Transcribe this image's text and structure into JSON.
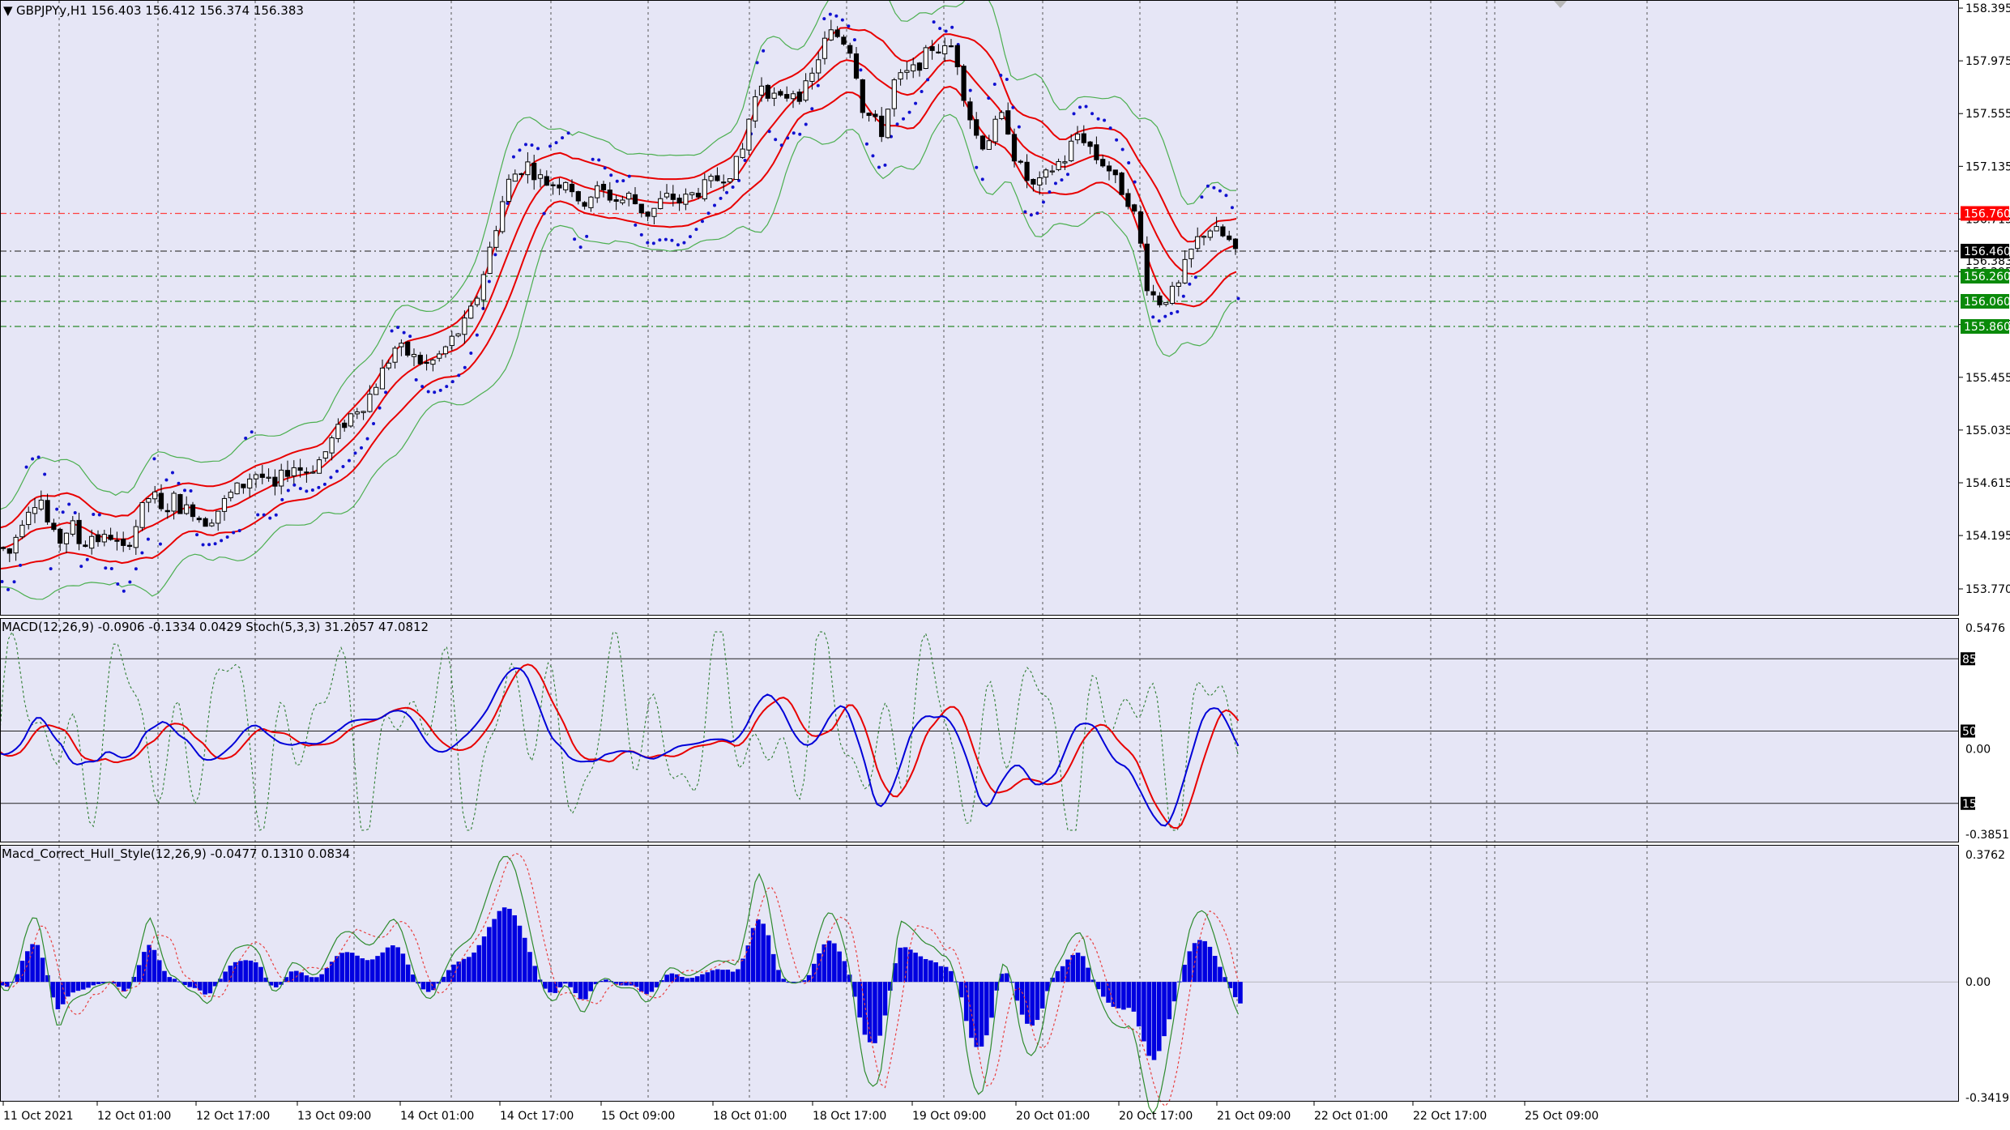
{
  "colors": {
    "background": "#e6e6f6",
    "candle_up": "#ffffff",
    "candle_down": "#000000",
    "envelope": "#e80000",
    "bollinger": "#4caf50",
    "psar": "#1010d0",
    "macd_main": "#0000d8",
    "macd_signal": "#e80000",
    "stoch": "#2e7d32",
    "hist": "#0000e0",
    "hull_main": "#2e8b2e",
    "hull_signal": "#e84040",
    "tag_red": "#ff0000",
    "tag_black": "#000000",
    "tag_green": "#0a8a0a",
    "hline_red": "#ff4040",
    "hline_black": "#444444",
    "hline_green": "#2a8a2a"
  },
  "panel1": {
    "header": "GBPJPYy,H1  156.403 156.412 156.374 156.383",
    "price_ticks": [
      "158.395",
      "157.975",
      "157.555",
      "157.135",
      "156.715",
      "156.295",
      "155.875",
      "155.455",
      "155.035",
      "154.615",
      "154.195",
      "153.770"
    ],
    "hidden_tick_fragment": "156.383",
    "price_tags": [
      {
        "text": "156.760",
        "color": "red",
        "level": 156.76
      },
      {
        "text": "156.460",
        "color": "black",
        "level": 156.46
      },
      {
        "text": "156.260",
        "color": "green",
        "level": 156.26
      },
      {
        "text": "156.060",
        "color": "green",
        "level": 156.06
      },
      {
        "text": "155.860",
        "color": "green",
        "level": 155.86
      }
    ]
  },
  "panel2": {
    "header": "MACD(12,26,9) -0.0906 -0.1334 0.0429  Stoch(5,3,3) 31.2057 47.0812",
    "ticks": [
      "0.5476",
      "0.00",
      "-0.3851"
    ],
    "level_tags": [
      "85",
      "50",
      "15"
    ]
  },
  "panel3": {
    "header": "Macd_Correct_Hull_Style(12,26,9) -0.0477 0.1310 0.0834",
    "ticks": [
      "0.3762",
      "0.00",
      "-0.3419"
    ]
  },
  "time_labels": [
    "11 Oct 2021",
    "12 Oct 01:00",
    "12 Oct 17:00",
    "13 Oct 09:00",
    "14 Oct 01:00",
    "14 Oct 17:00",
    "15 Oct 09:00",
    "18 Oct 01:00",
    "18 Oct 17:00",
    "19 Oct 09:00",
    "20 Oct 01:00",
    "20 Oct 17:00",
    "21 Oct 09:00",
    "22 Oct 01:00",
    "22 Oct 17:00",
    "25 Oct 09:00"
  ],
  "chart_data": {
    "type": "candlestick",
    "symbol": "GBPJPYy",
    "timeframe": "H1",
    "ylim": [
      153.77,
      158.395
    ],
    "close_path": [
      [
        0,
        154.1
      ],
      [
        10,
        154.05
      ],
      [
        20,
        154.3
      ],
      [
        30,
        154.45
      ],
      [
        40,
        154.5
      ],
      [
        50,
        154.2
      ],
      [
        60,
        154.15
      ],
      [
        70,
        154.3
      ],
      [
        80,
        154.1
      ],
      [
        90,
        154.2
      ],
      [
        100,
        154.15
      ],
      [
        110,
        154.2
      ],
      [
        120,
        154.05
      ],
      [
        130,
        154.2
      ],
      [
        140,
        154.4
      ],
      [
        150,
        154.55
      ],
      [
        160,
        154.35
      ],
      [
        170,
        154.5
      ],
      [
        180,
        154.4
      ],
      [
        190,
        154.4
      ],
      [
        200,
        154.3
      ],
      [
        210,
        154.35
      ],
      [
        220,
        154.45
      ],
      [
        230,
        154.55
      ],
      [
        240,
        154.6
      ],
      [
        250,
        154.7
      ],
      [
        260,
        154.65
      ],
      [
        270,
        154.55
      ],
      [
        280,
        154.7
      ],
      [
        290,
        154.75
      ],
      [
        300,
        154.7
      ],
      [
        310,
        154.75
      ],
      [
        320,
        154.85
      ],
      [
        330,
        155.0
      ],
      [
        340,
        155.1
      ],
      [
        350,
        155.2
      ],
      [
        360,
        155.25
      ],
      [
        370,
        155.4
      ],
      [
        380,
        155.55
      ],
      [
        390,
        155.7
      ],
      [
        400,
        155.65
      ],
      [
        410,
        155.6
      ],
      [
        420,
        155.55
      ],
      [
        430,
        155.6
      ],
      [
        440,
        155.7
      ],
      [
        450,
        155.8
      ],
      [
        460,
        155.9
      ],
      [
        470,
        156.1
      ],
      [
        480,
        156.4
      ],
      [
        490,
        156.7
      ],
      [
        500,
        157.0
      ],
      [
        510,
        157.1
      ],
      [
        520,
        157.15
      ],
      [
        530,
        157.05
      ],
      [
        540,
        157.0
      ],
      [
        550,
        157.0
      ],
      [
        560,
        157.05
      ],
      [
        570,
        156.8
      ],
      [
        580,
        156.9
      ],
      [
        590,
        156.95
      ],
      [
        600,
        156.9
      ],
      [
        610,
        156.85
      ],
      [
        620,
        156.9
      ],
      [
        630,
        156.8
      ],
      [
        640,
        156.75
      ],
      [
        650,
        156.85
      ],
      [
        660,
        156.9
      ],
      [
        670,
        156.85
      ],
      [
        680,
        156.9
      ],
      [
        690,
        156.95
      ],
      [
        700,
        157.0
      ],
      [
        710,
        157.05
      ],
      [
        720,
        157.1
      ],
      [
        730,
        157.2
      ],
      [
        740,
        157.6
      ],
      [
        750,
        157.8
      ],
      [
        760,
        157.7
      ],
      [
        770,
        157.65
      ],
      [
        780,
        157.75
      ],
      [
        790,
        157.7
      ],
      [
        800,
        157.85
      ],
      [
        810,
        158.1
      ],
      [
        820,
        158.2
      ],
      [
        830,
        158.15
      ],
      [
        840,
        158.05
      ],
      [
        850,
        157.6
      ],
      [
        860,
        157.5
      ],
      [
        870,
        157.4
      ],
      [
        880,
        157.8
      ],
      [
        890,
        157.85
      ],
      [
        900,
        157.9
      ],
      [
        910,
        158.0
      ],
      [
        920,
        158.1
      ],
      [
        930,
        158.05
      ],
      [
        940,
        158.1
      ],
      [
        950,
        157.7
      ],
      [
        960,
        157.4
      ],
      [
        970,
        157.3
      ],
      [
        980,
        157.45
      ],
      [
        990,
        157.55
      ],
      [
        1000,
        157.2
      ],
      [
        1010,
        157.05
      ],
      [
        1020,
        156.95
      ],
      [
        1030,
        157.05
      ],
      [
        1040,
        157.15
      ],
      [
        1050,
        157.2
      ],
      [
        1060,
        157.4
      ],
      [
        1070,
        157.35
      ],
      [
        1080,
        157.2
      ],
      [
        1090,
        157.15
      ],
      [
        1100,
        157.0
      ],
      [
        1110,
        156.9
      ],
      [
        1120,
        156.7
      ],
      [
        1130,
        156.2
      ],
      [
        1140,
        156.05
      ],
      [
        1150,
        156.1
      ],
      [
        1160,
        156.15
      ],
      [
        1170,
        156.4
      ],
      [
        1180,
        156.55
      ],
      [
        1190,
        156.65
      ],
      [
        1200,
        156.6
      ],
      [
        1210,
        156.55
      ],
      [
        1220,
        156.38
      ]
    ]
  }
}
